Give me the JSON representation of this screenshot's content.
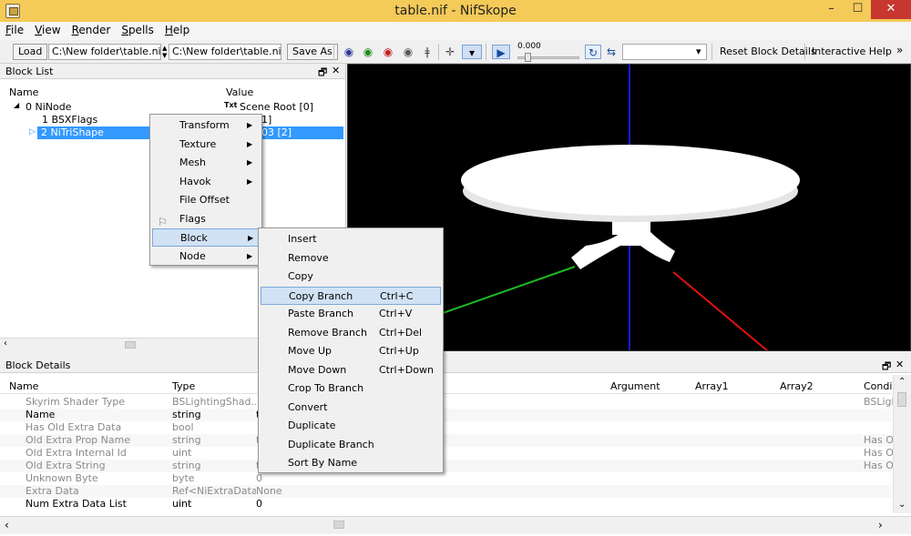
{
  "window": {
    "title": "table.nif - NifSkope",
    "min": "–",
    "max": "☐",
    "close": "✕"
  },
  "menubar": [
    "File",
    "View",
    "Render",
    "Spells",
    "Help"
  ],
  "toolbar": {
    "load_label": "Load",
    "load_path": "C:\\New folder\\table.nif",
    "save_path": "C:\\New folder\\table.nif",
    "save_as_label": "Save As",
    "slider_value": "0.000",
    "reset_label": "Reset Block Details",
    "help_label": "Interactive Help",
    "overflow": "»"
  },
  "block_list": {
    "title": "Block List",
    "col_name": "Name",
    "col_value": "Value",
    "rows": [
      {
        "name": "0 NiNode",
        "value": "Scene Root [0]",
        "value_prefix": "Txt"
      },
      {
        "name": "1 BSXFlags",
        "value": "1]"
      },
      {
        "name": "2 NiTriShape",
        "value": "03 [2]"
      }
    ]
  },
  "block_details": {
    "title": "Block Details",
    "cols": {
      "name": "Name",
      "type": "Type",
      "argument": "Argument",
      "array1": "Array1",
      "array2": "Array2",
      "cond": "Condi"
    },
    "rows": [
      {
        "name": "Skyrim Shader Type",
        "type": "BSLightingShad...",
        "value": "",
        "cond": "BSLigh",
        "gray": true
      },
      {
        "name": "Name",
        "type": "string",
        "value": "t",
        "cond": "",
        "gray": false
      },
      {
        "name": "Has Old Extra Data",
        "type": "bool",
        "value": "",
        "cond": "",
        "gray": true
      },
      {
        "name": "Old Extra Prop Name",
        "type": "string",
        "value": "t",
        "cond": "Has O",
        "gray": true
      },
      {
        "name": "Old Extra Internal Id",
        "type": "uint",
        "value": "",
        "cond": "Has O",
        "gray": true
      },
      {
        "name": "Old Extra String",
        "type": "string",
        "value": "t",
        "cond": "Has O",
        "gray": true
      },
      {
        "name": "Unknown Byte",
        "type": "byte",
        "value": "0",
        "cond": "",
        "gray": true
      },
      {
        "name": "Extra Data",
        "type": "Ref<NiExtraData>",
        "value": "None",
        "cond": "",
        "gray": true
      },
      {
        "name": "Num Extra Data List",
        "type": "uint",
        "value": "0",
        "cond": "",
        "gray": false
      }
    ]
  },
  "context_menu": {
    "items": [
      "Transform",
      "Texture",
      "Mesh",
      "Havok",
      "File Offset",
      "Flags",
      "Block",
      "Node"
    ],
    "submenu_flags": [
      true,
      true,
      true,
      true,
      false,
      false,
      true,
      true
    ]
  },
  "block_submenu": {
    "items": [
      {
        "label": "Insert",
        "shortcut": ""
      },
      {
        "label": "Remove",
        "shortcut": ""
      },
      {
        "label": "Copy",
        "shortcut": ""
      },
      {
        "label": "Copy Branch",
        "shortcut": "Ctrl+C"
      },
      {
        "label": "Paste Branch",
        "shortcut": "Ctrl+V"
      },
      {
        "label": "Remove Branch",
        "shortcut": "Ctrl+Del"
      },
      {
        "label": "Move Up",
        "shortcut": "Ctrl+Up"
      },
      {
        "label": "Move Down",
        "shortcut": "Ctrl+Down"
      },
      {
        "label": "Crop To Branch",
        "shortcut": ""
      },
      {
        "label": "Convert",
        "shortcut": ""
      },
      {
        "label": "Duplicate",
        "shortcut": ""
      },
      {
        "label": "Duplicate Branch",
        "shortcut": ""
      },
      {
        "label": "Sort By Name",
        "shortcut": ""
      }
    ]
  },
  "colors": {
    "title_bar": "#f4ca58",
    "selection": "#3399ff",
    "axis_x": "#e01010",
    "axis_y": "#1db81d",
    "axis_z": "#1a1ad8"
  }
}
